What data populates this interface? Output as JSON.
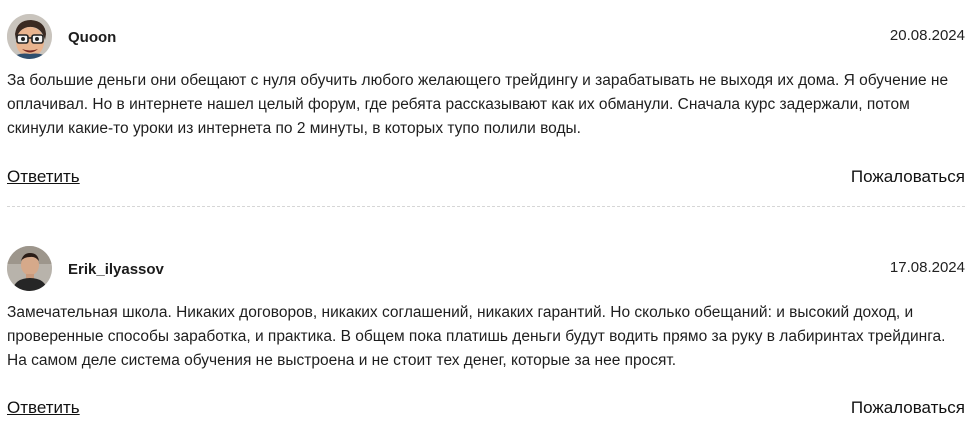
{
  "comments": [
    {
      "author": "Quoon",
      "date": "20.08.2024",
      "text": "За большие деньги они обещают с нуля обучить любого желающего трейдингу и зарабатывать не выходя их дома. Я обучение не оплачивал. Но в интернете нашел целый форум, где ребята рассказывают как их обманули. Сначала курс задержали, потом скинули какие-то уроки из интернета по 2 минуты, в которых тупо полили воды.",
      "reply_label": "Ответить",
      "report_label": "Пожаловаться",
      "avatar_icon": "cartoon-face-avatar"
    },
    {
      "author": "Erik_ilyassov",
      "date": "17.08.2024",
      "text": "Замечательная школа. Никаких договоров, никаких соглашений, никаких гарантий. Но сколько обещаний: и высокий доход, и проверенные способы заработка, и практика. В общем пока платишь деньги будут водить прямо за руку в лабиринтах трейдинга. На самом деле система обучения не выстроена и не стоит тех денег, которые за нее просят.",
      "reply_label": "Ответить",
      "report_label": "Пожаловаться",
      "avatar_icon": "user-photo-avatar"
    }
  ],
  "colors": {
    "text": "#1e1e1e",
    "divider": "#d6d6d6"
  }
}
